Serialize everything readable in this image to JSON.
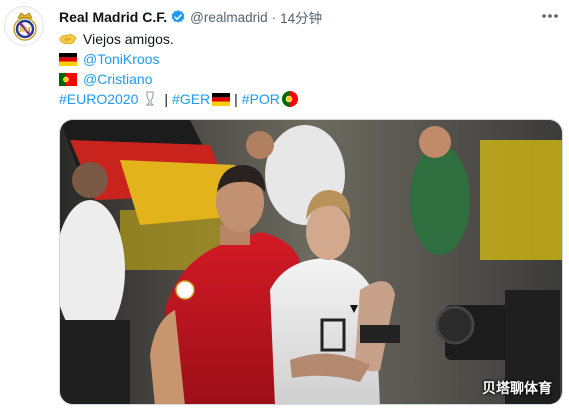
{
  "account": {
    "name": "Real Madrid C.F.",
    "handle": "@realmadrid",
    "separator": "·",
    "time": "14分钟"
  },
  "icons": {
    "avatar": "real-madrid-crest",
    "verified": "verified-badge-icon",
    "more": "more-options-icon"
  },
  "tweet": {
    "line1_text": "Viejos amigos.",
    "line2_mention": "@ToniKroos",
    "line3_mention": "@Cristiano",
    "hashtag_euro": "#EURO2020",
    "sep1": "|",
    "hashtag_ger": "#GER",
    "sep2": "|",
    "hashtag_por": "#POR"
  },
  "media": {
    "watermark": "贝塔聊体育",
    "description_icon": "photo-ronaldo-kroos"
  },
  "colors": {
    "link": "#1d9bf0",
    "portugal_red": "#c8102e",
    "germany_shirt": "#f2f2f2",
    "verified": "#1d9bf0"
  }
}
